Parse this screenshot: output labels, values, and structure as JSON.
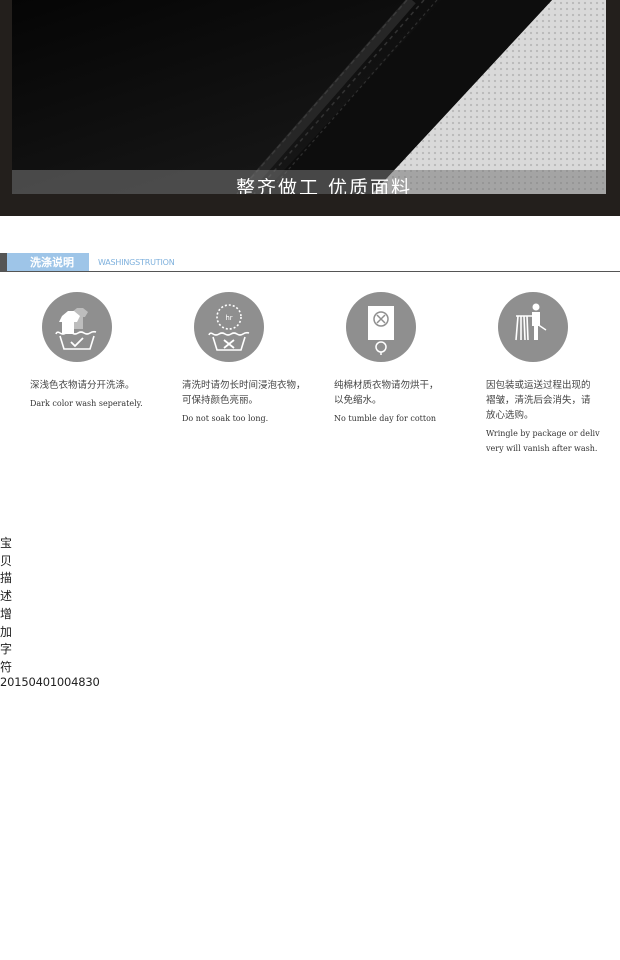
{
  "banner": {
    "caption": "整齐做工 优质面料"
  },
  "section": {
    "title": "洗涤说明",
    "subtitle": "WASHINGSTRUTION"
  },
  "cards": [
    {
      "icon": "tshirt-wash-icon",
      "zh": "深浅色衣物请分开洗涤。",
      "en": "Dark color wash seperately."
    },
    {
      "icon": "timer-basin-icon",
      "zh": "清洗时请勿长时间浸泡衣物，\n可保持颜色亮丽。",
      "en": "Do not soak too long."
    },
    {
      "icon": "no-tumble-dry-icon",
      "zh": "纯棉材质衣物请勿烘干，\n以免缩水。",
      "en": "No tumble day for cotton"
    },
    {
      "icon": "hanging-garment-icon",
      "zh": "因包装或运送过程出现的\n褶皱，清洗后会消失，请\n放心选购。",
      "en": "Wringle by package or deliv\nvery will vanish after wash."
    }
  ],
  "vertical_text": [
    "宝",
    "贝",
    "描",
    "述",
    "增",
    "加",
    "字",
    "符"
  ],
  "code": "20150401004830"
}
